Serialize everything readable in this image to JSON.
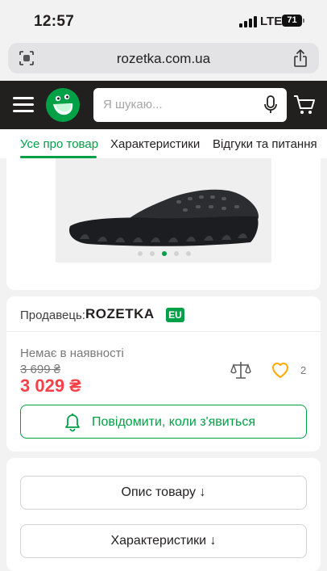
{
  "status_bar": {
    "time": "12:57",
    "network": "LTE",
    "battery": "71"
  },
  "browser": {
    "url": "rozetka.com.ua"
  },
  "header": {
    "search_placeholder": "Я шукаю..."
  },
  "tabs": [
    {
      "label": "Усе про товар",
      "active": true
    },
    {
      "label": "Характеристики",
      "active": false
    },
    {
      "label": "Відгуки та питання",
      "active": false
    }
  ],
  "gallery": {
    "total_slides": 5,
    "active_slide": 3
  },
  "seller": {
    "label": "Продавець:",
    "brand": "ROZETKA",
    "badge": "EU"
  },
  "product": {
    "availability": "Немає в наявності",
    "old_price": "3 699 ₴",
    "price": "3 029 ₴",
    "wishlist_count": "2"
  },
  "buttons": {
    "notify": "Повідомити, коли з'явиться",
    "description": "Опис товару ↓",
    "characteristics": "Характеристики ↓"
  },
  "colors": {
    "accent": "#00a046",
    "price": "#f84147",
    "header_bg": "#221f1f",
    "wishlist": "#ffa900"
  }
}
